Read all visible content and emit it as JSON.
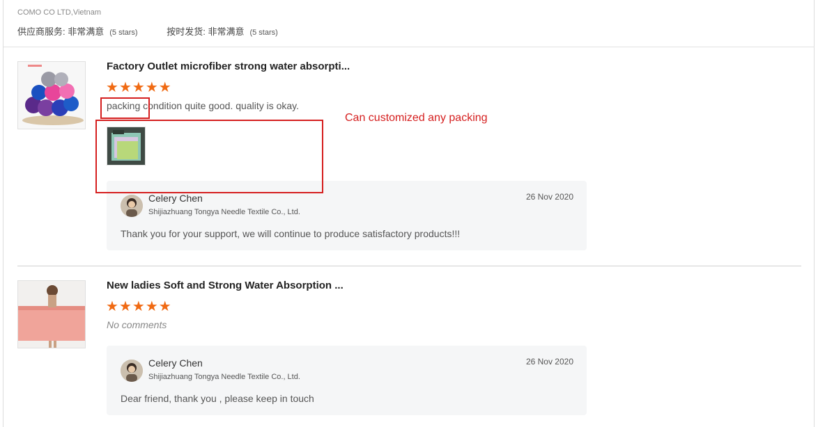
{
  "header": {
    "supplier": "COMO CO LTD,Vietnam",
    "service_label": "供应商服务: ",
    "service_value": "非常满意",
    "service_stars": "(5 stars)",
    "delivery_label": "按时发货: ",
    "delivery_value": "非常满意",
    "delivery_stars": "(5 stars)"
  },
  "reviews": [
    {
      "title": "Factory Outlet microfiber strong water absorpti...",
      "rating": 5,
      "comment": "packing condition quite good. quality is okay.",
      "reply": {
        "name": "Celery Chen",
        "company": "Shijiazhuang Tongya Needle Textile Co., Ltd.",
        "date": "26 Nov 2020",
        "text": "Thank you for your support, we will continue to produce satisfactory products!!!"
      }
    },
    {
      "title": "New ladies Soft and Strong Water Absorption ...",
      "rating": 5,
      "comment": "No comments",
      "reply": {
        "name": "Celery Chen",
        "company": "Shijiazhuang Tongya Needle Textile Co., Ltd.",
        "date": "26 Nov 2020",
        "text": "Dear friend, thank you , please keep in touch"
      }
    }
  ],
  "annotation": {
    "text": "Can customized any packing",
    "color": "#d51e1e"
  },
  "colors": {
    "star": "#f06a13",
    "reply_bg": "#f5f6f7"
  },
  "icons": [
    "star-icon"
  ]
}
